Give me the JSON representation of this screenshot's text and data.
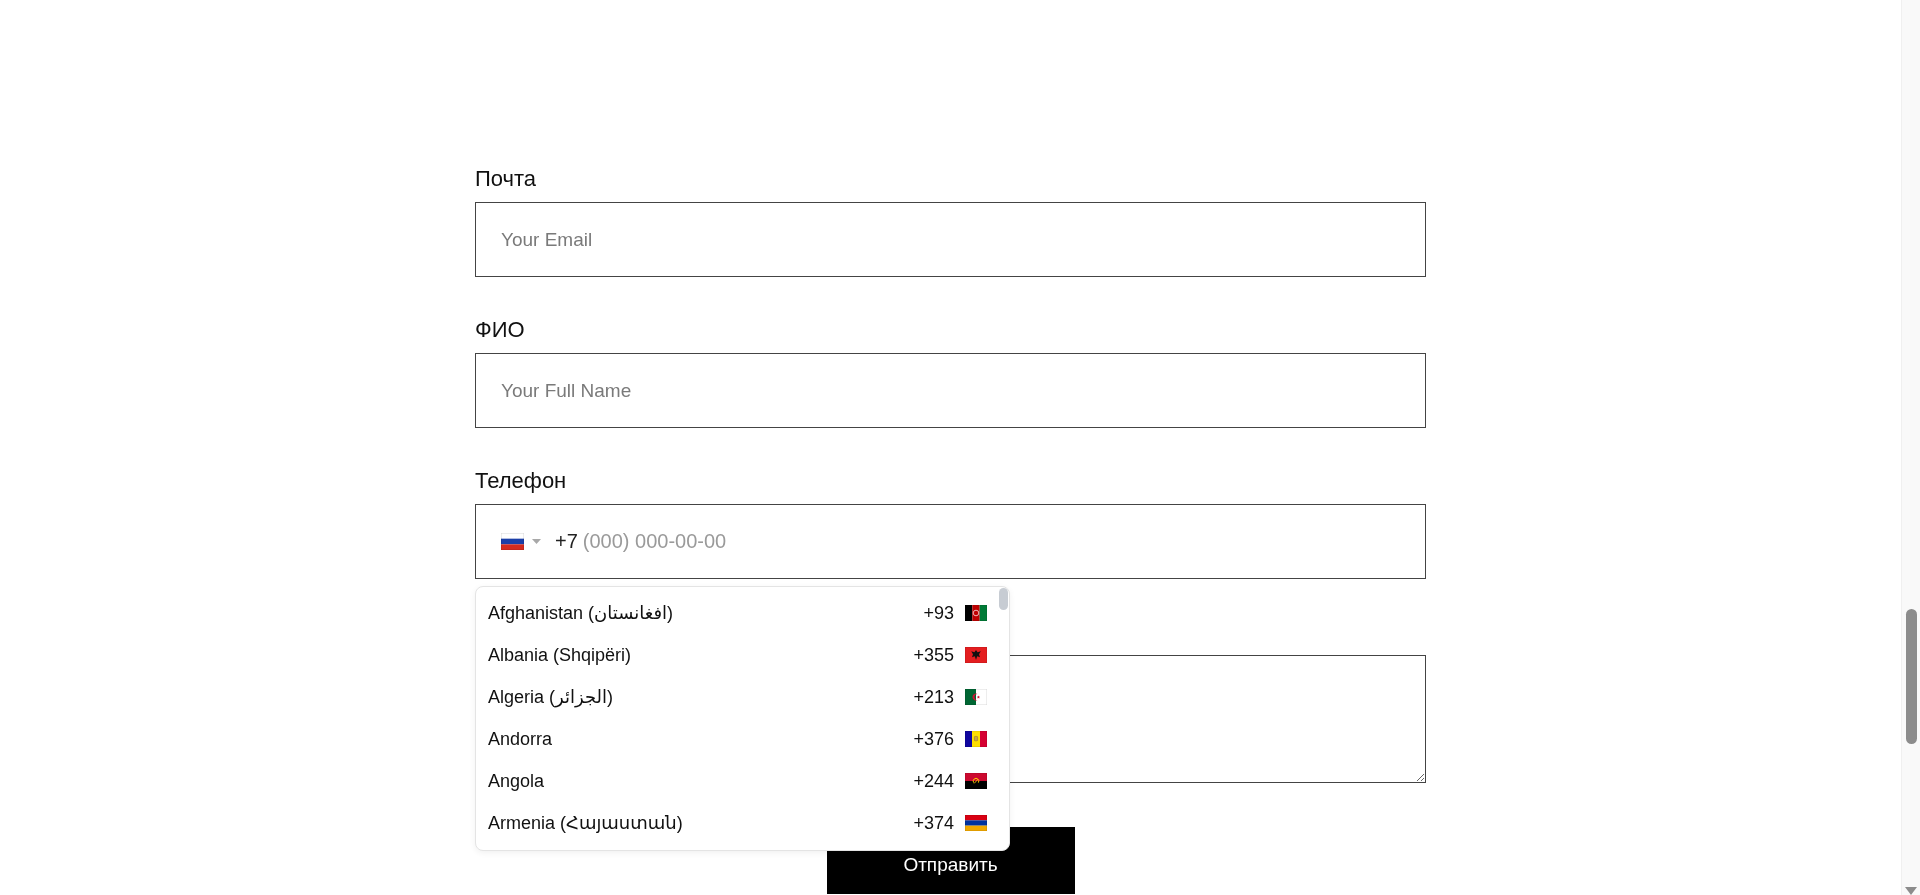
{
  "form": {
    "fields": [
      {
        "kind": "text",
        "label": "Почта",
        "placeholder": "Your Email"
      },
      {
        "kind": "text",
        "label": "ФИО",
        "placeholder": "Your Full Name"
      },
      {
        "kind": "phone",
        "label": "Телефон",
        "selected_flag": {
          "kind": "russia"
        },
        "prefix": "+7",
        "placeholder": "(000) 000-00-00",
        "expanded": true,
        "countries": [
          {
            "name": "Afghanistan (افغانستان)",
            "code": "+93",
            "kind": "afghanistan"
          },
          {
            "name": "Albania (Shqipëri)",
            "code": "+355",
            "kind": "albania"
          },
          {
            "name": "Algeria (الجزائر)",
            "code": "+213",
            "kind": "algeria"
          },
          {
            "name": "Andorra",
            "code": "+376",
            "kind": "andorra"
          },
          {
            "name": "Angola",
            "code": "+244",
            "kind": "angola"
          },
          {
            "name": "Armenia (Հայաստան)",
            "code": "+374",
            "kind": "armenia"
          }
        ]
      },
      {
        "kind": "textarea"
      }
    ],
    "submit": {
      "label": "Отправить"
    }
  }
}
